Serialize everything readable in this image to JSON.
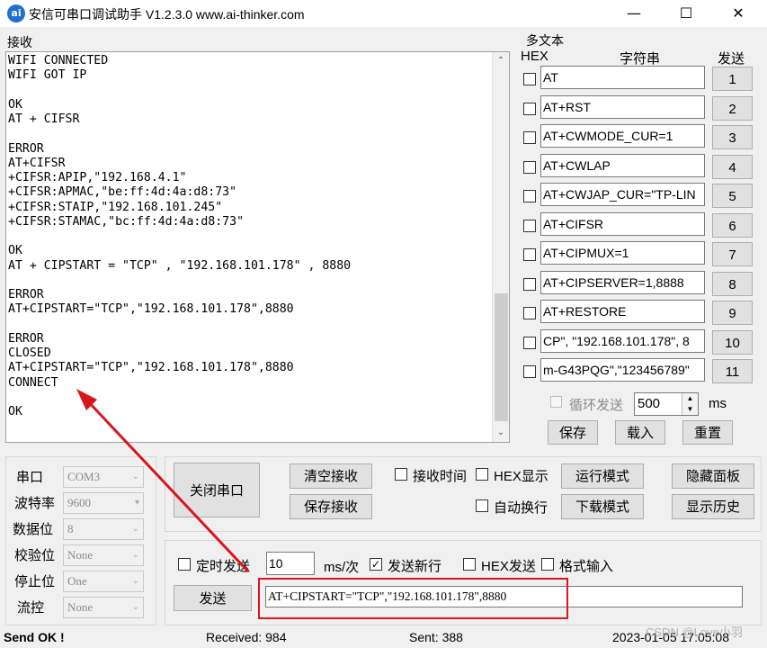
{
  "window": {
    "title": "安信可串口调试助手 V1.2.3.0    www.ai-thinker.com",
    "icon_text": "ai",
    "minimize": "—",
    "maximize": "☐",
    "close": "✕"
  },
  "receive": {
    "label": "接收",
    "text": "WIFI CONNECTED\nWIFI GOT IP\n\nOK\nAT + CIFSR\n\nERROR\nAT+CIFSR\n+CIFSR:APIP,\"192.168.4.1\"\n+CIFSR:APMAC,\"be:ff:4d:4a:d8:73\"\n+CIFSR:STAIP,\"192.168.101.245\"\n+CIFSR:STAMAC,\"bc:ff:4d:4a:d8:73\"\n\nOK\nAT + CIPSTART = \"TCP\" , \"192.168.101.178\" , 8880\n\nERROR\nAT+CIPSTART=\"TCP\",\"192.168.101.178\",8880\n\nERROR\nCLOSED\nAT+CIPSTART=\"TCP\",\"192.168.101.178\",8880\nCONNECT\n\nOK"
  },
  "multitext": {
    "label": "多文本",
    "hex_header": "HEX",
    "string_header": "字符串",
    "send_header": "发送",
    "rows": [
      {
        "text": "AT",
        "num": "1"
      },
      {
        "text": "AT+RST",
        "num": "2"
      },
      {
        "text": "AT+CWMODE_CUR=1",
        "num": "3"
      },
      {
        "text": "AT+CWLAP",
        "num": "4"
      },
      {
        "text": "AT+CWJAP_CUR=\"TP-LIN",
        "num": "5"
      },
      {
        "text": "AT+CIFSR",
        "num": "6"
      },
      {
        "text": "AT+CIPMUX=1",
        "num": "7"
      },
      {
        "text": "AT+CIPSERVER=1,8888",
        "num": "8"
      },
      {
        "text": "AT+RESTORE",
        "num": "9"
      },
      {
        "text": "CP\", \"192.168.101.178\", 8",
        "num": "10"
      },
      {
        "text": "m-G43PQG\",\"123456789\"",
        "num": "11"
      }
    ],
    "loop_label": "循环发送",
    "loop_value": "500",
    "loop_unit": "ms",
    "save": "保存",
    "load": "载入",
    "reset": "重置"
  },
  "settings": {
    "port_label": "串口",
    "port_value": "COM3",
    "baud_label": "波特率",
    "baud_value": "9600",
    "data_label": "数据位",
    "data_value": "8",
    "parity_label": "校验位",
    "parity_value": "None",
    "stop_label": "停止位",
    "stop_value": "One",
    "flow_label": "流控",
    "flow_value": "None"
  },
  "controls": {
    "close_port": "关闭串口",
    "clear_recv": "清空接收",
    "save_recv": "保存接收",
    "recv_time": "接收时间",
    "hex_show": "HEX显示",
    "run_mode": "运行模式",
    "hide_panel": "隐藏面板",
    "auto_wrap": "自动换行",
    "download_mode": "下载模式",
    "show_history": "显示历史"
  },
  "send": {
    "timed_label": "定时发送",
    "interval": "10",
    "interval_unit": "ms/次",
    "newline_label": "发送新行",
    "hex_send_label": "HEX发送",
    "format_label": "格式输入",
    "send_button": "发送",
    "input_value": "AT+CIPSTART=\"TCP\",\"192.168.101.178\",8880"
  },
  "status": {
    "send_ok": "Send OK !",
    "received": "Received: 984",
    "sent": "Sent: 388",
    "datetime": "2023-01-05 17:05:08",
    "watermark": "CSDN @Love小羽"
  },
  "annotation_color": "#d9161c"
}
